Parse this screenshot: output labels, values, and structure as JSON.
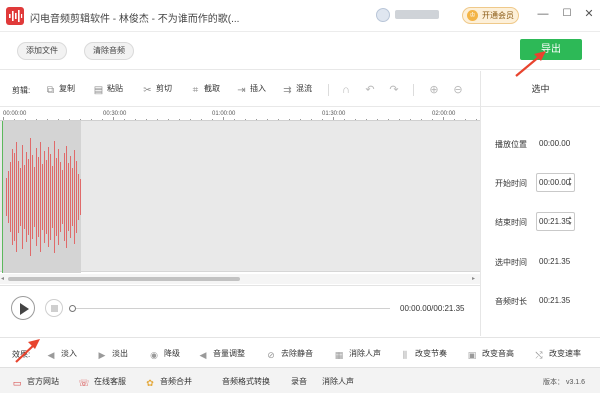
{
  "app": {
    "title": "闪电音频剪辑软件 - 林俊杰 - 不为谁而作的歌(...",
    "vip_label": "开通会员",
    "vip_icon": "crown-icon",
    "window_buttons": [
      "—",
      "☐",
      "✕"
    ]
  },
  "topbar": {
    "add_file": "添加文件",
    "clear_audio": "清除音频",
    "export": "导出"
  },
  "toolbar": {
    "label": "剪辑:",
    "items": [
      {
        "label": "复制",
        "icon": "copy-icon"
      },
      {
        "label": "粘贴",
        "icon": "paste-icon"
      },
      {
        "label": "剪切",
        "icon": "scissors-icon"
      },
      {
        "label": "截取",
        "icon": "crop-icon"
      },
      {
        "label": "插入",
        "icon": "insert-icon"
      },
      {
        "label": "混流",
        "icon": "mix-icon"
      }
    ],
    "extra_icons": [
      "headphones-icon",
      "undo-icon",
      "redo-icon",
      "zoom-in-icon",
      "zoom-out-icon"
    ]
  },
  "timeline": {
    "ticks": [
      "00:00:00",
      "00:30:00",
      "01:00:00",
      "01:30:00",
      "02:00:00"
    ]
  },
  "player": {
    "time": "00:00.00/00:21.35",
    "progress": 0
  },
  "panel": {
    "title": "选中",
    "rows": [
      {
        "label": "播放位置",
        "value": "00:00.00"
      },
      {
        "label": "开始时间",
        "value": "00:00.00"
      },
      {
        "label": "结束时间",
        "value": "00:21.35"
      },
      {
        "label": "选中时间",
        "value": "00:21.35"
      },
      {
        "label": "音频时长",
        "value": "00:21.35"
      }
    ]
  },
  "effects": {
    "label": "效果:",
    "items": [
      {
        "label": "淡入",
        "icon": "fade-in-icon"
      },
      {
        "label": "淡出",
        "icon": "fade-out-icon"
      },
      {
        "label": "降级",
        "icon": "downgrade-icon"
      },
      {
        "label": "音量调整",
        "icon": "volume-icon"
      },
      {
        "label": "去除静音",
        "icon": "mute-remove-icon"
      },
      {
        "label": "消除人声",
        "icon": "vocal-remove-icon"
      },
      {
        "label": "改变节奏",
        "icon": "tempo-icon"
      },
      {
        "label": "改变音高",
        "icon": "pitch-icon"
      },
      {
        "label": "改变速率",
        "icon": "rate-icon"
      }
    ]
  },
  "bottombar": {
    "items": [
      {
        "label": "官方网站",
        "icon": "monitor-icon"
      },
      {
        "label": "在线客服",
        "icon": "support-icon"
      },
      {
        "label": "音频合并",
        "icon": "merge-icon"
      },
      {
        "label": "音频格式转换",
        "icon": ""
      },
      {
        "label": "录音",
        "icon": ""
      },
      {
        "label": "消除人声",
        "icon": ""
      }
    ],
    "version": "版本： v3.1.6"
  },
  "colors": {
    "accent": "#2db957",
    "waveform": "#e06a6a",
    "annotation": "#e8442e"
  }
}
